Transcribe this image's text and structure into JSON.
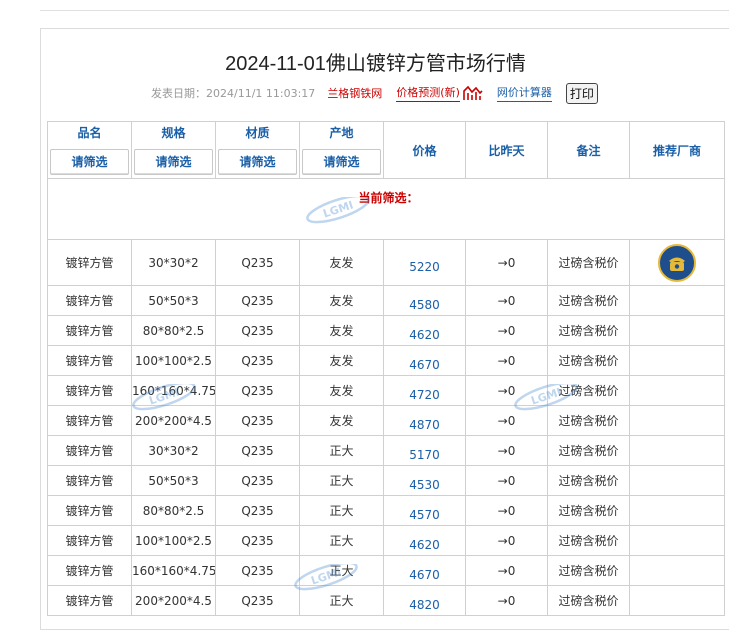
{
  "page": {
    "title": "2024-11-01佛山镀锌方管市场行情",
    "date_label": "发表日期：2024/11/1 11:03:17",
    "source_link": "兰格钢铁网",
    "forecast_link": "价格预测(新)",
    "calculator_link": "网价计算器",
    "print_button": "打印"
  },
  "table": {
    "headers": {
      "product": "品名",
      "spec": "规格",
      "material": "材质",
      "origin": "产地",
      "price": "价格",
      "change": "比昨天",
      "remark": "备注",
      "vendor": "推荐厂商"
    },
    "filter_button": "请筛选",
    "current_filter_label": "当前筛选：",
    "rows": [
      {
        "product": "镀锌方管",
        "spec": "30*30*2",
        "material": "Q235",
        "origin": "友发",
        "price": "5220",
        "change": "→0",
        "remark": "过磅含税价"
      },
      {
        "product": "镀锌方管",
        "spec": "50*50*3",
        "material": "Q235",
        "origin": "友发",
        "price": "4580",
        "change": "→0",
        "remark": "过磅含税价"
      },
      {
        "product": "镀锌方管",
        "spec": "80*80*2.5",
        "material": "Q235",
        "origin": "友发",
        "price": "4620",
        "change": "→0",
        "remark": "过磅含税价"
      },
      {
        "product": "镀锌方管",
        "spec": "100*100*2.5",
        "material": "Q235",
        "origin": "友发",
        "price": "4670",
        "change": "→0",
        "remark": "过磅含税价"
      },
      {
        "product": "镀锌方管",
        "spec": "160*160*4.75",
        "material": "Q235",
        "origin": "友发",
        "price": "4720",
        "change": "→0",
        "remark": "过磅含税价"
      },
      {
        "product": "镀锌方管",
        "spec": "200*200*4.5",
        "material": "Q235",
        "origin": "友发",
        "price": "4870",
        "change": "→0",
        "remark": "过磅含税价"
      },
      {
        "product": "镀锌方管",
        "spec": "30*30*2",
        "material": "Q235",
        "origin": "正大",
        "price": "5170",
        "change": "→0",
        "remark": "过磅含税价"
      },
      {
        "product": "镀锌方管",
        "spec": "50*50*3",
        "material": "Q235",
        "origin": "正大",
        "price": "4530",
        "change": "→0",
        "remark": "过磅含税价"
      },
      {
        "product": "镀锌方管",
        "spec": "80*80*2.5",
        "material": "Q235",
        "origin": "正大",
        "price": "4570",
        "change": "→0",
        "remark": "过磅含税价"
      },
      {
        "product": "镀锌方管",
        "spec": "100*100*2.5",
        "material": "Q235",
        "origin": "正大",
        "price": "4620",
        "change": "→0",
        "remark": "过磅含税价"
      },
      {
        "product": "镀锌方管",
        "spec": "160*160*4.75",
        "material": "Q235",
        "origin": "正大",
        "price": "4670",
        "change": "→0",
        "remark": "过磅含税价"
      },
      {
        "product": "镀锌方管",
        "spec": "200*200*4.5",
        "material": "Q235",
        "origin": "正大",
        "price": "4820",
        "change": "→0",
        "remark": "过磅含税价"
      }
    ]
  },
  "colors": {
    "link_blue": "#1a5fa8",
    "accent_red": "#cc0000"
  },
  "icons": {
    "forecast": "trend-chart-icon",
    "vendor": "phone-icon",
    "watermark": "lange-logo-watermark"
  }
}
